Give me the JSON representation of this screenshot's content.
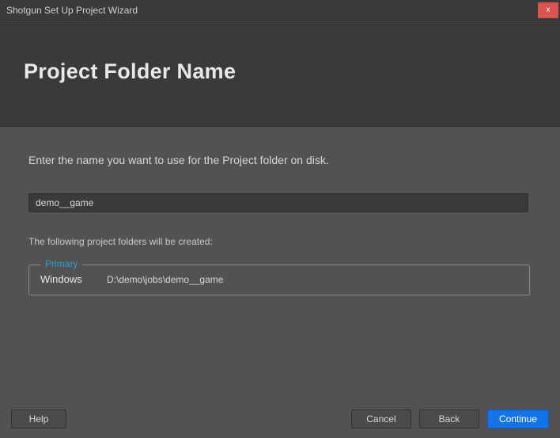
{
  "titlebar": {
    "title": "Shotgun Set Up Project Wizard",
    "close_glyph": "x"
  },
  "header": {
    "title": "Project Folder Name"
  },
  "content": {
    "instruction": "Enter the name you want to use for the Project folder on disk.",
    "folder_value": "demo__game",
    "created_label": "The following project folders will be created:"
  },
  "primary": {
    "legend": "Primary",
    "os_label": "Windows",
    "os_path": "D:\\demo\\jobs\\demo__game"
  },
  "footer": {
    "help": "Help",
    "cancel": "Cancel",
    "back": "Back",
    "continue": "Continue"
  }
}
